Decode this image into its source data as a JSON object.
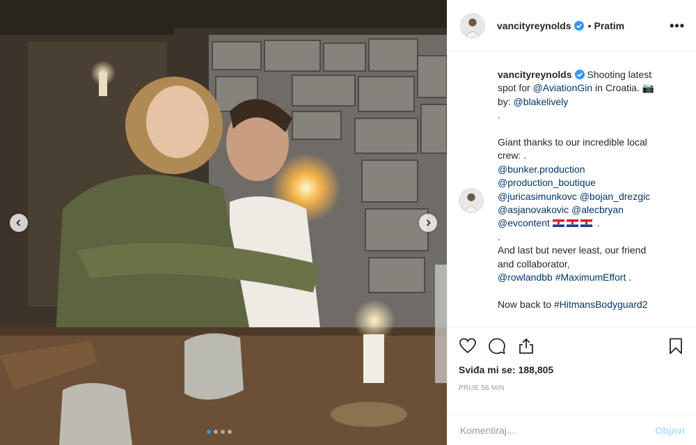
{
  "post": {
    "username": "vancityreynolds",
    "follow_status": "Pratim",
    "bullet": "•",
    "more_icon": "more-horizontal-icon",
    "more_label": "•••"
  },
  "caption": {
    "username": "vancityreynolds",
    "lines": [
      [
        {
          "t": "Shooting latest",
          "tag": false
        }
      ],
      [
        {
          "t": "spot for ",
          "tag": false
        },
        {
          "t": "@AviationGin",
          "tag": true
        },
        {
          "t": " in Croatia. 📷",
          "tag": false
        }
      ],
      [
        {
          "t": "by: ",
          "tag": false
        },
        {
          "t": "@blakelively",
          "tag": true
        }
      ],
      [
        {
          "t": ".",
          "tag": false
        }
      ],
      [],
      [
        {
          "t": "Giant thanks to our incredible local",
          "tag": false
        }
      ],
      [
        {
          "t": "crew: .",
          "tag": false
        }
      ],
      [
        {
          "t": "@bunker.production",
          "tag": true
        }
      ],
      [
        {
          "t": "@production_boutique",
          "tag": true
        }
      ],
      [
        {
          "t": "@juricasimunkovc",
          "tag": true
        },
        {
          "t": " ",
          "tag": false
        },
        {
          "t": "@bojan_drezgic",
          "tag": true
        }
      ],
      [
        {
          "t": "@asjanovakovic",
          "tag": true
        },
        {
          "t": " ",
          "tag": false
        },
        {
          "t": "@alecbryan",
          "tag": true
        }
      ],
      [
        {
          "t": "@evcontent",
          "tag": true
        },
        {
          "t": " ",
          "tag": false
        },
        {
          "flags": 3
        },
        {
          "t": " .",
          "tag": false
        }
      ],
      [
        {
          "t": ".",
          "tag": false
        }
      ],
      [
        {
          "t": "And last but never least, our friend",
          "tag": false
        }
      ],
      [
        {
          "t": "and collaborator,",
          "tag": false
        }
      ],
      [
        {
          "t": "@rowlandbb",
          "tag": true
        },
        {
          "t": " ",
          "tag": false
        },
        {
          "t": "#MaximumEffort",
          "tag": true
        },
        {
          "t": " .",
          "tag": false
        }
      ],
      [],
      [
        {
          "t": "Now back to ",
          "tag": false
        },
        {
          "t": "#HitmansBodyguard2",
          "tag": true
        }
      ]
    ]
  },
  "actions": {
    "like_icon": "heart-icon",
    "comment_icon": "comment-icon",
    "share_icon": "share-icon",
    "save_icon": "bookmark-icon",
    "likes_label": "Sviđa mi se: 188,805",
    "timestamp": "PRIJE 56 MIN"
  },
  "comment_box": {
    "placeholder": "Komentiraj...",
    "publish_label": "Objavi"
  },
  "carousel": {
    "prev_icon": "chevron-left-icon",
    "next_icon": "chevron-right-icon",
    "slide_count": 4,
    "active_index": 0
  },
  "colors": {
    "link": "#003569",
    "verified": "#3897f0",
    "publish_disabled": "#b2dffc",
    "muted": "#999999"
  }
}
